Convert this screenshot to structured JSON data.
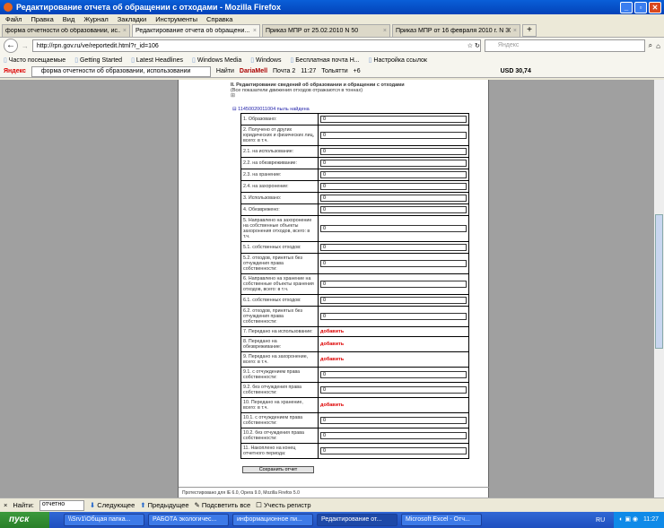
{
  "window": {
    "title": "Редактирование отчета об обращении с отходами - Mozilla Firefox"
  },
  "menu": [
    "Файл",
    "Правка",
    "Вид",
    "Журнал",
    "Закладки",
    "Инструменты",
    "Справка"
  ],
  "tabs": [
    {
      "label": "форма отчетности об образовании, ис..."
    },
    {
      "label": "Редактирование отчета об обращени..."
    },
    {
      "label": "Приказ МПР от 25.02.2010 N 50"
    },
    {
      "label": "Приказ МПР от 16 февраля 2010 г. N 30"
    }
  ],
  "nav": {
    "url": "http://rpn.gov.ru/ve/reportedit.html?r_id=106",
    "search_placeholder": "Яндекс"
  },
  "bookmarks": [
    "Часто посещаемые",
    "Getting Started",
    "Latest Headlines",
    "Windows Media",
    "Windows",
    "Бесплатная почта Н...",
    "Настройка ссылок"
  ],
  "yandex": {
    "logo": "Яндекс",
    "query": "форма отчетности об образовании, использовании",
    "find": "Найти",
    "user": "DariaMell",
    "mail": "Почта 2",
    "time": "11:27",
    "city": "Тольятти",
    "temp": "+6",
    "usd": "USD 30,74"
  },
  "form": {
    "heading": "II. Редактирование сведений об образовании и обращении с отходами",
    "subheading": "(Все показатели движения отходов отражаются в тоннах)",
    "expand": "⊞",
    "waste_link": "⊟ 11450020011004 пыль найдена",
    "add_label": "добавить",
    "rows": [
      {
        "label": "1. Образовано:",
        "value": "0"
      },
      {
        "label": "2. Получено от других юридических и физических лиц, всего: в т.ч.",
        "value": "0"
      },
      {
        "label": "2.1. на использование:",
        "value": "0"
      },
      {
        "label": "2.2. на обезвреживание:",
        "value": "0"
      },
      {
        "label": "2.3. на хранение:",
        "value": "0"
      },
      {
        "label": "2.4. на захоронение:",
        "value": "0"
      },
      {
        "label": "3. Использовано:",
        "value": "0"
      },
      {
        "label": "4. Обезврежено:",
        "value": "0"
      },
      {
        "label": "5. Направлено на захоронение на собственные объекты захоронения отходов, всего: в т.ч.",
        "value": "0"
      },
      {
        "label": "5.1. собственных отходов:",
        "value": "0"
      },
      {
        "label": "5.2. отходов, принятых без отчуждения права собственности:",
        "value": "0"
      },
      {
        "label": "6. Направлено на хранение на собственные объекты хранения отходов, всего: в т.ч.",
        "value": "0"
      },
      {
        "label": "6.1. собственных отходов:",
        "value": "0"
      },
      {
        "label": "6.2. отходов, принятых без отчуждения права собственности:",
        "value": "0"
      },
      {
        "label": "7. Передано на использование:",
        "add": true
      },
      {
        "label": "8. Передано на обезвреживание:",
        "add": true
      },
      {
        "label": "9. Передано на захоронение, всего: в т.ч.",
        "add": true
      },
      {
        "label": "9.1. с отчуждением права собственности:",
        "value": "0"
      },
      {
        "label": "9.2. без отчуждения права собственности:",
        "value": "0"
      },
      {
        "label": "10. Передано на хранение, всего: в т.ч.",
        "add": true
      },
      {
        "label": "10.1. с отчуждением права собственности:",
        "value": "0"
      },
      {
        "label": "10.2. без отчуждения права собственности:",
        "value": "0"
      },
      {
        "label": "11. Накоплено на конец отчетного периода:",
        "value": "0"
      }
    ],
    "save": "Сохранить отчет",
    "footer": "Протестировано для IE 6.0, Opera 9.0, Mozilla Firefox 5.0"
  },
  "findbar": {
    "label": "Найти:",
    "value": "отчетно",
    "next": "Следующее",
    "prev": "Предыдущее",
    "highlight": "Подсветить все",
    "case": "Учесть регистр"
  },
  "taskbar": {
    "start": "пуск",
    "tasks": [
      "\\\\Srv1\\Общая папка...",
      "РАБОТА экологичес...",
      "информационное пи...",
      "Редактирование от...",
      "Microsoft Excel - Отч..."
    ],
    "lang": "RU",
    "clock": "11:27"
  }
}
